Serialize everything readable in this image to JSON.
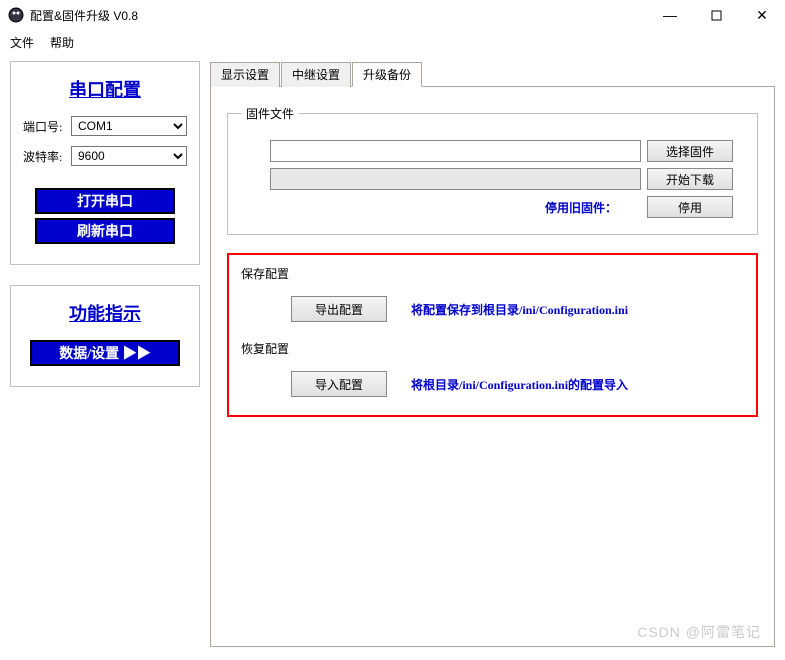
{
  "window": {
    "title": "配置&固件升级 V0.8"
  },
  "menu": {
    "file": "文件",
    "help": "帮助"
  },
  "serial": {
    "title": "串口配置",
    "port_label": "端口号:",
    "port_value": "COM1",
    "baud_label": "波特率:",
    "baud_value": "9600",
    "open_btn": "打开串口",
    "refresh_btn": "刷新串口"
  },
  "func": {
    "title": "功能指示",
    "data_btn": "数据/设置   ▶▶"
  },
  "tabs": {
    "t1": "显示设置",
    "t2": "中继设置",
    "t3": "升级备份"
  },
  "firmware": {
    "legend": "固件文件",
    "select_btn": "选择固件",
    "start_btn": "开始下载",
    "stop_label": "停用旧固件：",
    "stop_btn": "停用"
  },
  "save_cfg": {
    "label": "保存配置",
    "btn": "导出配置",
    "desc": "将配置保存到根目录/ini/Configuration.ini"
  },
  "restore_cfg": {
    "label": "恢复配置",
    "btn": "导入配置",
    "desc": "将根目录/ini/Configuration.ini的配置导入"
  },
  "watermark": "CSDN @阿雷笔记"
}
